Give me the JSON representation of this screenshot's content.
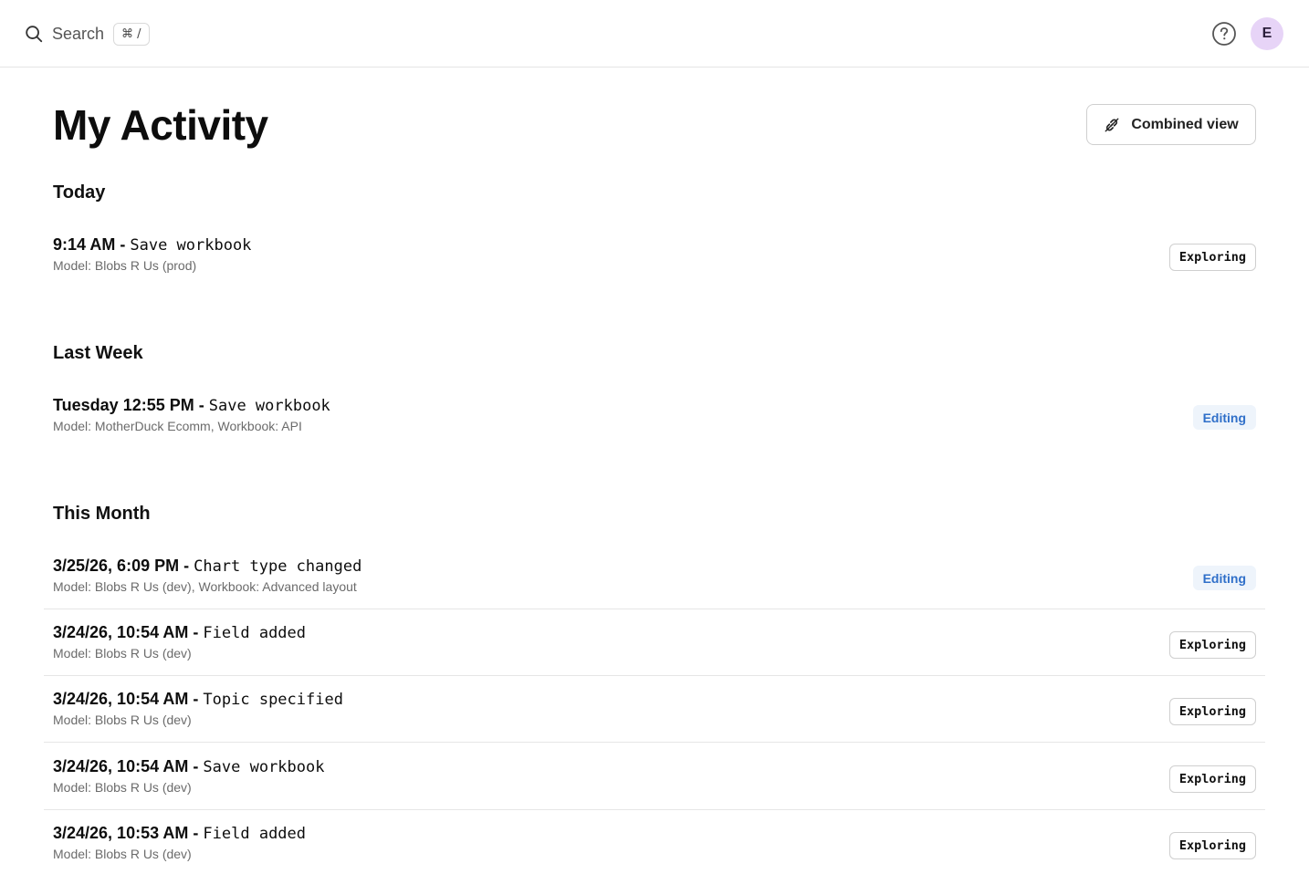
{
  "topbar": {
    "search_label": "Search",
    "search_shortcut": "⌘ /",
    "search_icon": "search-icon",
    "help_icon": "help-circle-icon",
    "avatar_initial": "E"
  },
  "page": {
    "title": "My Activity",
    "combined_view_label": "Combined view",
    "combined_view_icon": "link-icon"
  },
  "sections": [
    {
      "title": "Today",
      "items": [
        {
          "time": "9:14 AM",
          "separator": " - ",
          "action": "Save workbook",
          "details": "Model: Blobs R Us (prod)",
          "mode": "Exploring"
        }
      ]
    },
    {
      "title": "Last Week",
      "items": [
        {
          "time": "Tuesday 12:55 PM",
          "separator": " - ",
          "action": "Save workbook",
          "details": "Model: MotherDuck Ecomm, Workbook: API",
          "mode": "Editing"
        }
      ]
    },
    {
      "title": "This Month",
      "items": [
        {
          "time": "3/25/26, 6:09 PM",
          "separator": " - ",
          "action": "Chart type changed",
          "details": "Model: Blobs R Us (dev), Workbook: Advanced layout",
          "mode": "Editing"
        },
        {
          "time": "3/24/26, 10:54 AM",
          "separator": " - ",
          "action": "Field added",
          "details": "Model: Blobs R Us (dev)",
          "mode": "Exploring"
        },
        {
          "time": "3/24/26, 10:54 AM",
          "separator": " - ",
          "action": "Topic specified",
          "details": "Model: Blobs R Us (dev)",
          "mode": "Exploring"
        },
        {
          "time": "3/24/26, 10:54 AM",
          "separator": " - ",
          "action": "Save workbook",
          "details": "Model: Blobs R Us (dev)",
          "mode": "Exploring"
        },
        {
          "time": "3/24/26, 10:53 AM",
          "separator": " - ",
          "action": "Field added",
          "details": "Model: Blobs R Us (dev)",
          "mode": "Exploring"
        }
      ]
    }
  ],
  "colors": {
    "accent_blue": "#2f6fc9",
    "editing_badge_bg": "#eef4fb",
    "avatar_bg": "#e7d4f7"
  }
}
